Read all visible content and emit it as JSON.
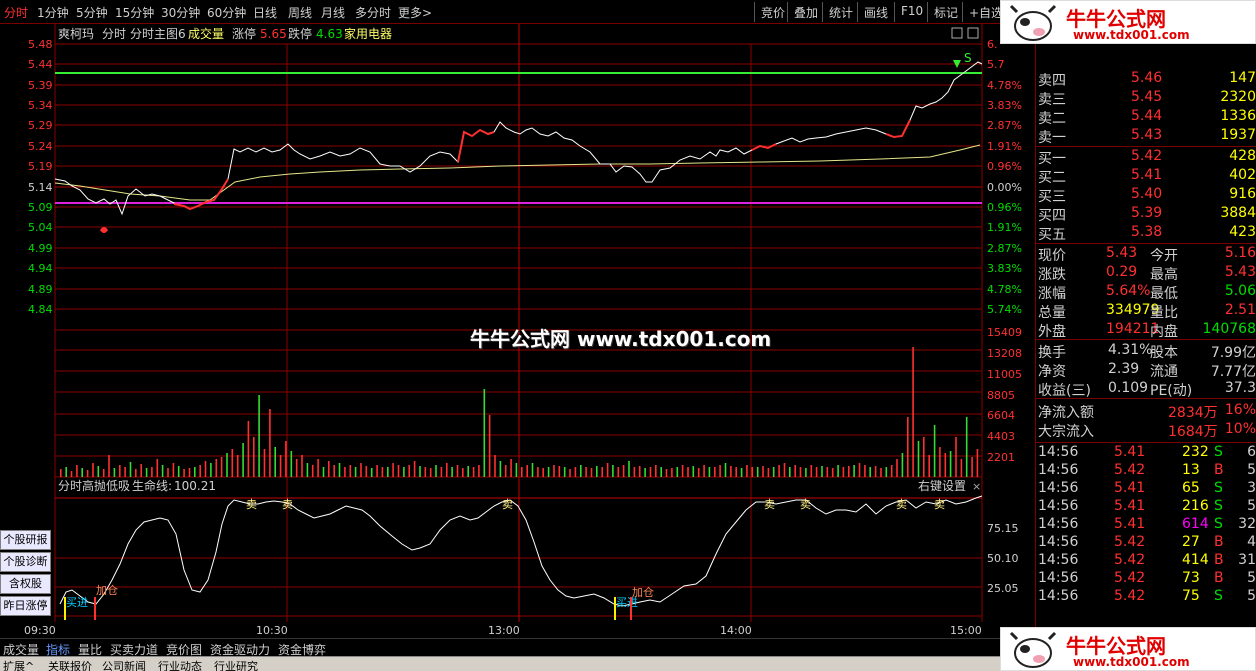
{
  "topbar": {
    "periods": [
      "分时",
      "1分钟",
      "5分钟",
      "15分钟",
      "30分钟",
      "60分钟",
      "日线",
      "周线",
      "月线",
      "多分时",
      "更多>"
    ],
    "right_buttons": [
      "竞价",
      "叠加",
      "统计",
      "画线",
      "F10",
      "标记",
      "+自选"
    ]
  },
  "header": {
    "stock_name": "爽柯玛",
    "mode": "分时",
    "formula": "分时主图6",
    "volume_label": "成交量",
    "zt_label": "涨停",
    "zt_value": "5.65",
    "dt_label": "跌停",
    "dt_value": "4.63",
    "sector": "家用电器"
  },
  "price_axis": [
    "5.48",
    "5.44",
    "5.39",
    "5.34",
    "5.29",
    "5.24",
    "5.19",
    "5.14",
    "5.09",
    "5.04",
    "4.99",
    "4.94",
    "4.89",
    "4.84"
  ],
  "pct_axis": [
    "6.",
    "5.7",
    "4.78%",
    "3.83%",
    "2.87%",
    "1.91%",
    "0.96%",
    "0.00%",
    "0.96%",
    "1.91%",
    "2.87%",
    "3.83%",
    "4.78%",
    "5.74%"
  ],
  "vol_axis": [
    "15409",
    "13208",
    "11005",
    "8805",
    "6604",
    "4403",
    "2201"
  ],
  "indicator": {
    "name": "分时高抛低吸",
    "line_label": "生命线:",
    "line_value": "100.21",
    "settings": "右键设置",
    "axis": [
      "75.15",
      "50.10",
      "25.05"
    ],
    "sell_label": "卖",
    "buy_label": "买进",
    "add_label": "加仓"
  },
  "time_axis": [
    "09:30",
    "10:30",
    "13:00",
    "14:00",
    "15:00"
  ],
  "center_watermark": "牛牛公式网 www.tdx001.com",
  "sidebar_buttons": [
    "个股研报",
    "个股诊断",
    "含权股",
    "昨日涨停"
  ],
  "bottom_tabs": [
    "成交量",
    "指标",
    "量比",
    "买卖力道",
    "竞价图",
    "资金驱动力",
    "资金博弈"
  ],
  "status_tabs": [
    "扩展^",
    "关联报价",
    "公司新闻",
    "行业动态",
    "行业研究"
  ],
  "watermark": {
    "title": "牛牛公式网",
    "url": "www.tdx001.com"
  },
  "order_book": {
    "sell": [
      {
        "label": "卖四",
        "price": "5.46",
        "vol": "147"
      },
      {
        "label": "卖三",
        "price": "5.45",
        "vol": "2320"
      },
      {
        "label": "卖二",
        "price": "5.44",
        "vol": "1336"
      },
      {
        "label": "卖一",
        "price": "5.43",
        "vol": "1937"
      }
    ],
    "buy": [
      {
        "label": "买一",
        "price": "5.42",
        "vol": "428"
      },
      {
        "label": "买二",
        "price": "5.41",
        "vol": "402"
      },
      {
        "label": "买三",
        "price": "5.40",
        "vol": "916"
      },
      {
        "label": "买四",
        "price": "5.39",
        "vol": "3884"
      },
      {
        "label": "买五",
        "price": "5.38",
        "vol": "423"
      }
    ]
  },
  "quote": [
    {
      "l1": "现价",
      "v1": "5.43",
      "l2": "今开",
      "v2": "5.16",
      "c1": "#ff3030",
      "c2": "#ff3030"
    },
    {
      "l1": "涨跌",
      "v1": "0.29",
      "l2": "最高",
      "v2": "5.43",
      "c1": "#ff3030",
      "c2": "#ff3030"
    },
    {
      "l1": "涨幅",
      "v1": "5.64%",
      "l2": "最低",
      "v2": "5.06",
      "c1": "#ff3030",
      "c2": "#00dd00"
    },
    {
      "l1": "总量",
      "v1": "334979",
      "l2": "量比",
      "v2": "2.51",
      "c1": "#ffff00",
      "c2": "#ff3030"
    },
    {
      "l1": "外盘",
      "v1": "194211",
      "l2": "内盘",
      "v2": "140768",
      "c1": "#ff3030",
      "c2": "#00dd00"
    }
  ],
  "fundamentals": [
    {
      "l1": "换手",
      "v1": "4.31%",
      "l2": "股本",
      "v2": "7.99亿"
    },
    {
      "l1": "净资",
      "v1": "2.39",
      "l2": "流通",
      "v2": "7.77亿"
    },
    {
      "l1": "收益(三)",
      "v1": "0.109",
      "l2": "PE(动)",
      "v2": "37.3"
    }
  ],
  "flows": [
    {
      "label": "净流入额",
      "amount": "2834万",
      "pct": "16%"
    },
    {
      "label": "大宗流入",
      "amount": "1684万",
      "pct": "10%"
    }
  ],
  "ticks": [
    {
      "t": "14:56",
      "p": "5.41",
      "v": "232",
      "bs": "S",
      "n": "6",
      "pc": "#ff3030",
      "vc": "#ffff00",
      "bsc": "#00dd00"
    },
    {
      "t": "14:56",
      "p": "5.42",
      "v": "13",
      "bs": "B",
      "n": "5",
      "pc": "#ff3030",
      "vc": "#ffff00",
      "bsc": "#ff3030"
    },
    {
      "t": "14:56",
      "p": "5.41",
      "v": "65",
      "bs": "S",
      "n": "3",
      "pc": "#ff3030",
      "vc": "#ffff00",
      "bsc": "#00dd00"
    },
    {
      "t": "14:56",
      "p": "5.41",
      "v": "216",
      "bs": "S",
      "n": "5",
      "pc": "#ff3030",
      "vc": "#ffff00",
      "bsc": "#00dd00"
    },
    {
      "t": "14:56",
      "p": "5.41",
      "v": "614",
      "bs": "S",
      "n": "32",
      "pc": "#ff3030",
      "vc": "#ff00ff",
      "bsc": "#00dd00"
    },
    {
      "t": "14:56",
      "p": "5.42",
      "v": "27",
      "bs": "B",
      "n": "4",
      "pc": "#ff3030",
      "vc": "#ffff00",
      "bsc": "#ff3030"
    },
    {
      "t": "14:56",
      "p": "5.42",
      "v": "414",
      "bs": "B",
      "n": "31",
      "pc": "#ff3030",
      "vc": "#ffff00",
      "bsc": "#ff3030"
    },
    {
      "t": "14:56",
      "p": "5.42",
      "v": "73",
      "bs": "B",
      "n": "5",
      "pc": "#ff3030",
      "vc": "#ffff00",
      "bsc": "#ff3030"
    },
    {
      "t": "14:56",
      "p": "5.42",
      "v": "75",
      "bs": "S",
      "n": "5",
      "pc": "#ff3030",
      "vc": "#ffff00",
      "bsc": "#00dd00"
    }
  ]
}
